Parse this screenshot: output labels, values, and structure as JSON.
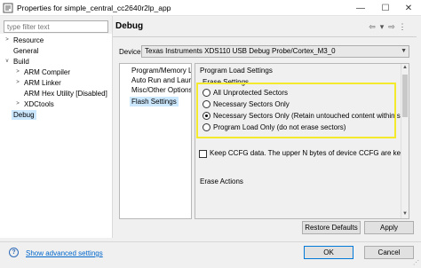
{
  "window": {
    "title": "Properties for simple_central_cc2640r2lp_app",
    "minimize_glyph": "—",
    "maximize_glyph": "☐",
    "close_glyph": "✕"
  },
  "filter": {
    "placeholder": "type filter text"
  },
  "tree": {
    "items": [
      {
        "label": "Resource",
        "arrow": ">"
      },
      {
        "label": "General"
      },
      {
        "label": "Build",
        "arrow": "v"
      },
      {
        "label": "ARM Compiler",
        "arrow": ">"
      },
      {
        "label": "ARM Linker",
        "arrow": ">"
      },
      {
        "label": "ARM Hex Utility  [Disabled]"
      },
      {
        "label": "XDCtools",
        "arrow": ">"
      },
      {
        "label": "Debug",
        "selected": true
      }
    ]
  },
  "page": {
    "title": "Debug",
    "nav_back": "⇦",
    "nav_menu": "▾",
    "nav_forward": "⇨",
    "nav_more": "⋮"
  },
  "device": {
    "label": "Device",
    "value": "Texas Instruments XDS110 USB Debug Probe/Cortex_M3_0"
  },
  "sublist": {
    "items": [
      {
        "label": "Program/Memory Load Options"
      },
      {
        "label": "Auto Run and Launch Options"
      },
      {
        "label": "Misc/Other Options"
      },
      {
        "label": "Flash Settings",
        "selected": true
      }
    ]
  },
  "detail": {
    "section": "Program Load Settings",
    "erase_group": "Erase Settings",
    "radios": [
      {
        "label": "All Unprotected Sectors",
        "checked": false
      },
      {
        "label": "Necessary Sectors Only",
        "checked": false
      },
      {
        "label": "Necessary Sectors Only (Retain untouched content within sector)",
        "checked": true
      },
      {
        "label": "Program Load Only (do not erase sectors)",
        "checked": false
      }
    ],
    "keep_ccfg": "Keep CCFG data. The upper N bytes of device CCFG are kept. N",
    "erase_actions": "Erase Actions"
  },
  "buttons": {
    "restore": "Restore Defaults",
    "apply": "Apply",
    "ok": "OK",
    "cancel": "Cancel"
  },
  "footer": {
    "help_glyph": "?",
    "advanced_link": "Show advanced settings"
  },
  "colors": {
    "highlight": "#f2ea2b",
    "selection": "#cce8ff",
    "link": "#0066cc",
    "primary_border": "#0078d7"
  }
}
